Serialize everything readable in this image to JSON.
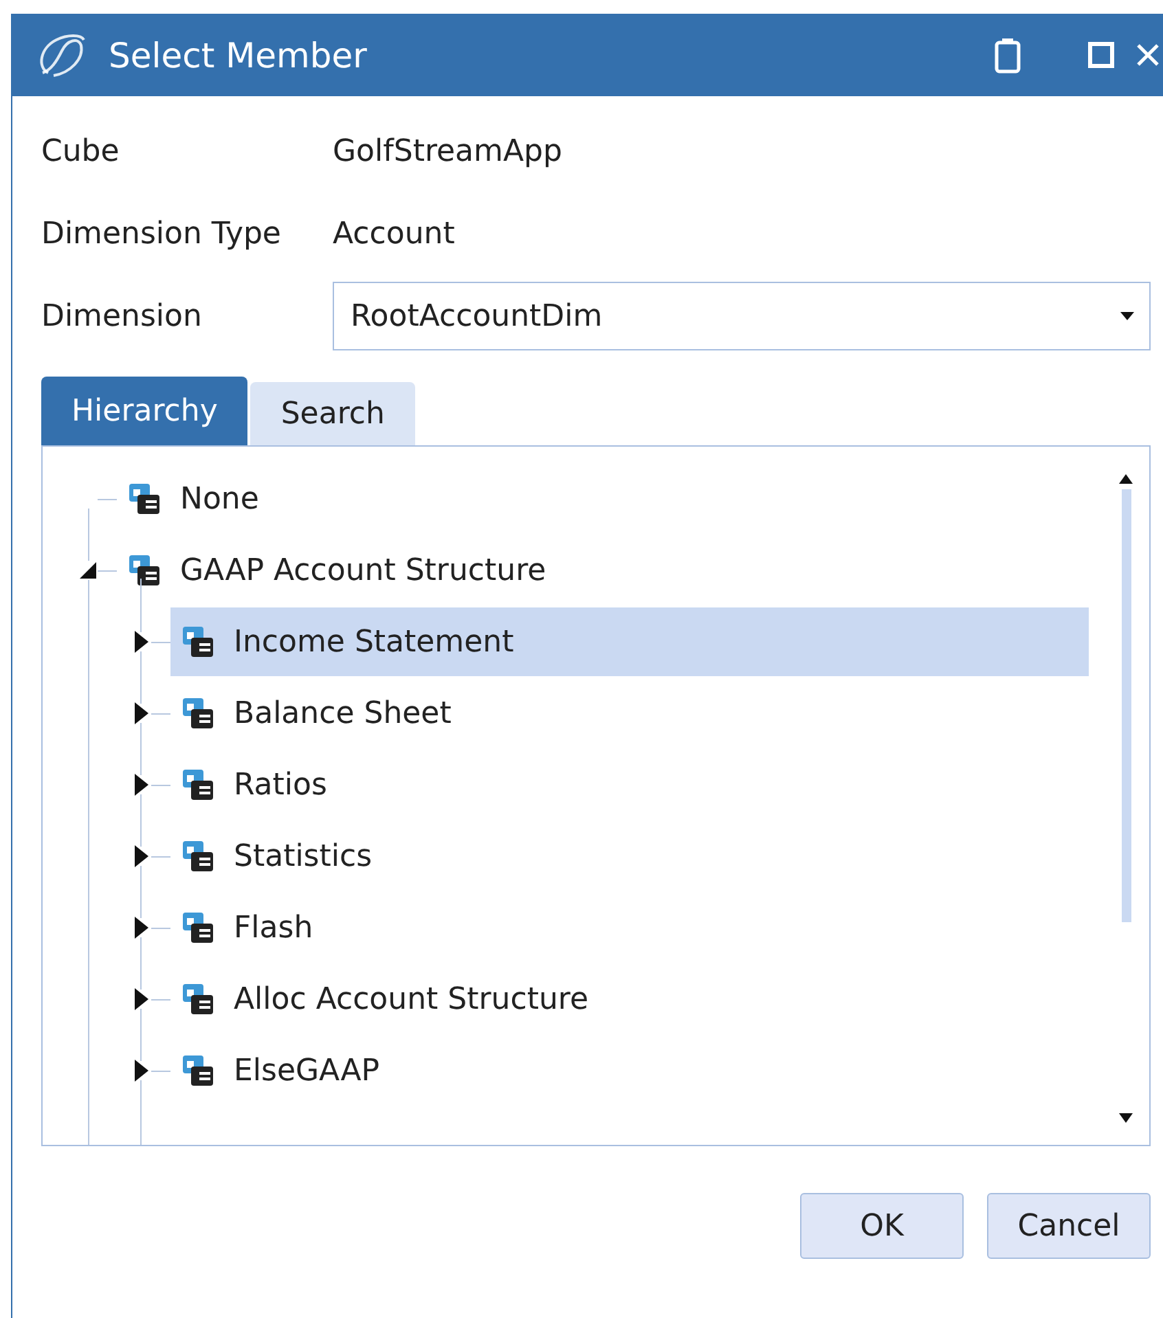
{
  "window": {
    "title": "Select Member"
  },
  "fields": [
    {
      "label": "Cube",
      "value": "GolfStreamApp",
      "kind": "text"
    },
    {
      "label": "Dimension Type",
      "value": "Account",
      "kind": "text"
    },
    {
      "label": "Dimension",
      "value": "RootAccountDim",
      "kind": "dropdown"
    }
  ],
  "tabs": [
    {
      "label": "Hierarchy",
      "selected": true
    },
    {
      "label": "Search",
      "selected": false
    }
  ],
  "tree": [
    {
      "label": "None",
      "selected": false
    },
    {
      "label": "GAAP Account Structure",
      "selected": false,
      "expanded": true,
      "children": [
        {
          "label": "Income Statement",
          "selected": true,
          "expanded": false
        },
        {
          "label": "Balance Sheet",
          "selected": false,
          "expanded": false
        },
        {
          "label": "Ratios",
          "selected": false,
          "expanded": false
        },
        {
          "label": "Statistics",
          "selected": false,
          "expanded": false
        },
        {
          "label": "Flash",
          "selected": false,
          "expanded": false
        },
        {
          "label": "Alloc Account Structure",
          "selected": false,
          "expanded": false
        },
        {
          "label": "ElseGAAP",
          "selected": false,
          "expanded": false
        }
      ]
    }
  ],
  "buttons": [
    "OK",
    "Cancel"
  ]
}
